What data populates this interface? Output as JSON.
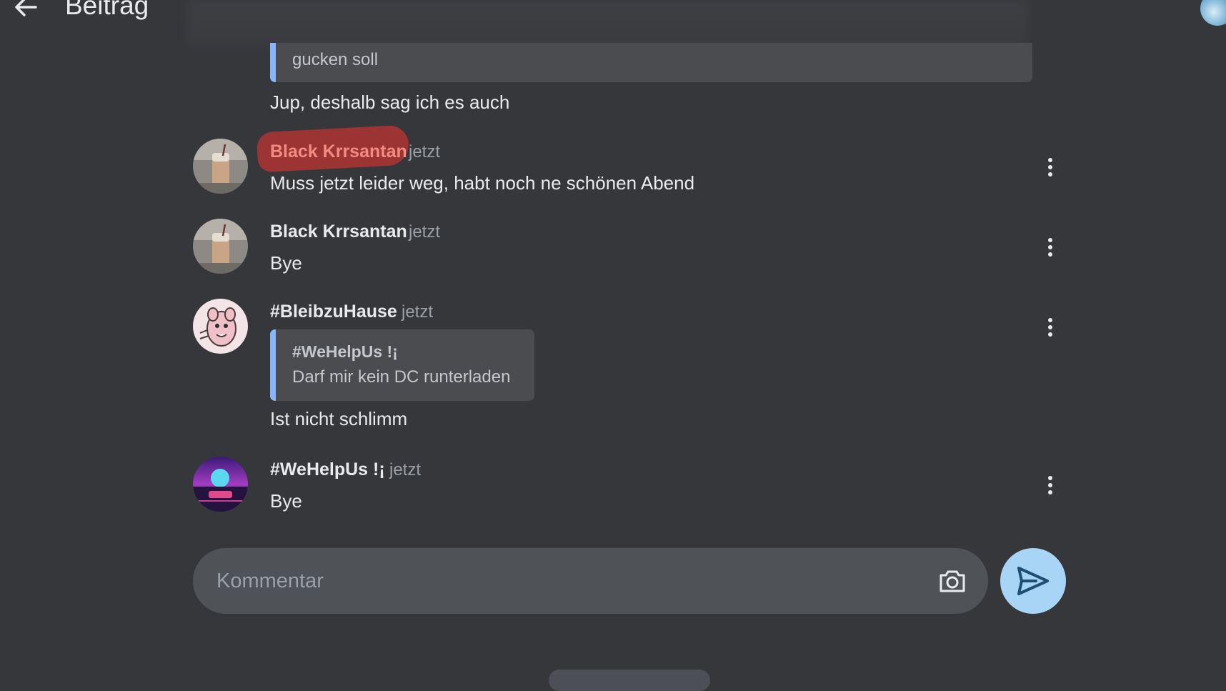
{
  "header": {
    "title": "Beitrag"
  },
  "previous": {
    "quote_text": "gucken soll",
    "reply_text": "Jup, deshalb sag ich es auch"
  },
  "comments": [
    {
      "author": "Black Krrsantan",
      "time": "jetzt",
      "text": "Muss jetzt leider weg, habt noch ne schönen Abend",
      "redacted_mark": true
    },
    {
      "author": "Black Krrsantan",
      "time": "jetzt",
      "text": "Bye"
    },
    {
      "author": "#BleibzuHause",
      "time": "jetzt",
      "quote": {
        "author": "#WeHelpUs !¡",
        "text": "Darf mir kein DC runterladen"
      },
      "text": "Ist nicht schlimm"
    },
    {
      "author": "#WeHelpUs !¡",
      "time": "jetzt",
      "text": "Bye"
    }
  ],
  "composer": {
    "placeholder": "Kommentar",
    "value": ""
  },
  "icons": {
    "back": "arrow-left-icon",
    "more": "more-vertical-icon",
    "camera": "camera-icon",
    "send": "send-icon"
  },
  "colors": {
    "background": "#35373b",
    "quote_accent": "#8ab4f8",
    "send_button": "#a8d4f5",
    "redaction": "#a23434",
    "redacted_name": "#f28b82"
  }
}
